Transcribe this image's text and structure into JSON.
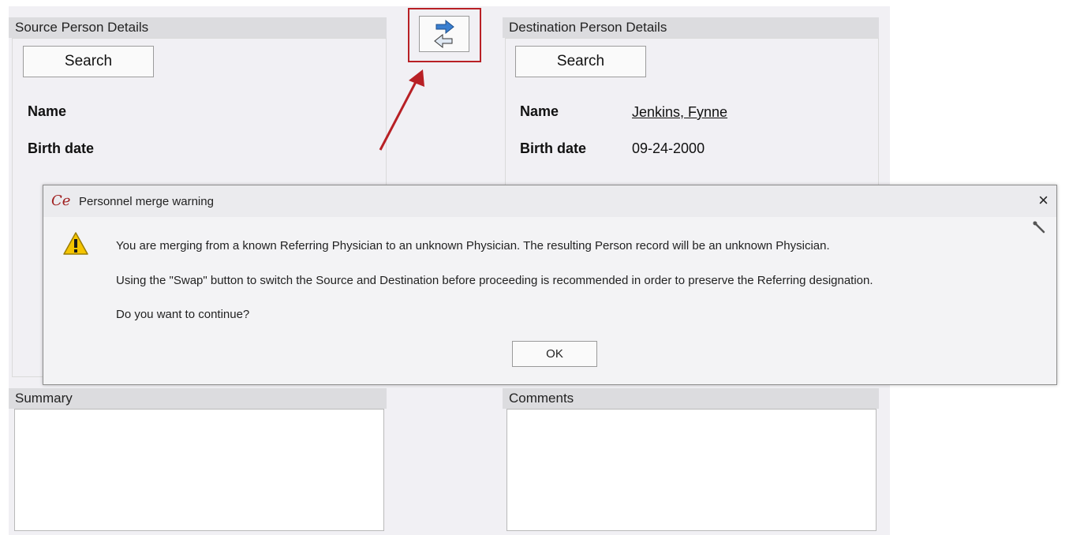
{
  "source": {
    "header": "Source Person Details",
    "search_label": "Search",
    "labels": {
      "name": "Name",
      "birth_date": "Birth date"
    }
  },
  "destination": {
    "header": "Destination Person Details",
    "search_label": "Search",
    "labels": {
      "name": "Name",
      "birth_date": "Birth date"
    },
    "values": {
      "name": "Jenkins, Fynne",
      "birth_date": "09-24-2000"
    }
  },
  "summary": {
    "header": "Summary"
  },
  "comments": {
    "header": "Comments"
  },
  "swap_button": {
    "icon": "swap-arrows-icon",
    "accent": "#3a7fd0",
    "highlight": "#b82025"
  },
  "dialog": {
    "title": "Personnel merge warning",
    "message_1": "You are merging from a known Referring Physician to an unknown Physician. The resulting Person record will be an unknown Physician.",
    "message_2": "Using the \"Swap\" button to switch the Source and Destination before proceeding is recommended in order to preserve the Referring designation.",
    "message_3": "Do you want to continue?",
    "ok_label": "OK",
    "close_glyph": "×",
    "logo_glyph": "Ce"
  }
}
